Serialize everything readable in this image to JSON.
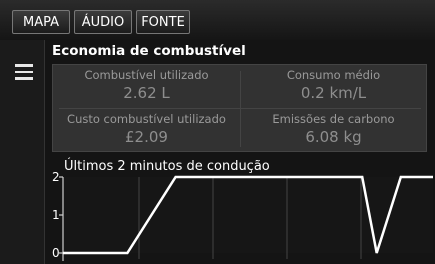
{
  "tabs": [
    {
      "label": "MAPA"
    },
    {
      "label": "ÁUDIO"
    },
    {
      "label": "FONTE"
    }
  ],
  "screen": {
    "title": "Economia de combustível"
  },
  "stats": [
    {
      "label": "Combustível utilizado",
      "value": "2.62 L"
    },
    {
      "label": "Consumo médio",
      "value": "0.2 km/L"
    },
    {
      "label": "Custo combustível utilizado",
      "value": "£2.09"
    },
    {
      "label": "Emissões de carbono",
      "value": "6.08 kg"
    }
  ],
  "chart_data": {
    "type": "line",
    "title": "Últimos 2 minutos de condução",
    "yticks": [
      "0",
      "1",
      "2"
    ],
    "ylim": [
      0,
      2
    ],
    "x": [
      0,
      1,
      2,
      3.5,
      8,
      9.3,
      9.75,
      10.5,
      11.5
    ],
    "values": [
      0,
      0,
      0,
      2,
      2,
      2,
      0,
      2,
      2
    ],
    "grid": true
  },
  "colors": {
    "background": "#000000",
    "panel": "#323232",
    "line": "#ffffff",
    "grid": "#444444"
  }
}
